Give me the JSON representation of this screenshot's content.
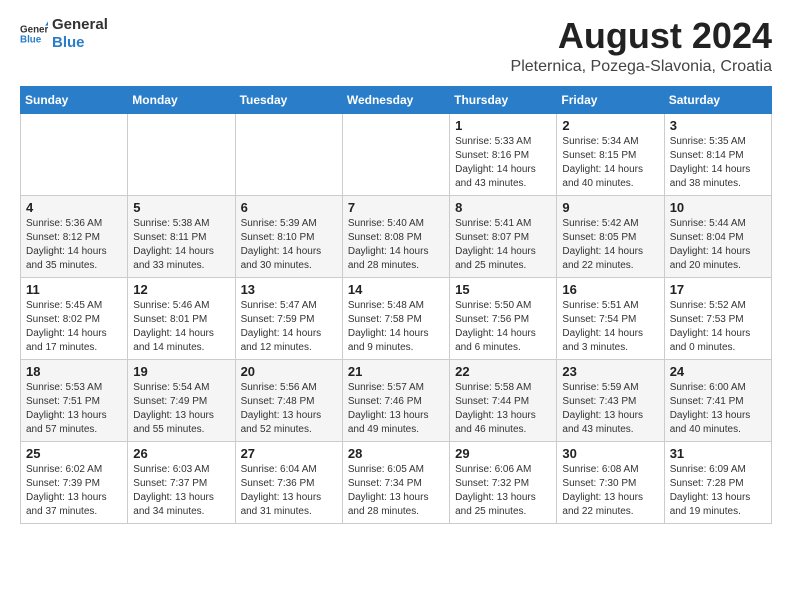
{
  "header": {
    "logo_general": "General",
    "logo_blue": "Blue",
    "month_title": "August 2024",
    "location": "Pleternica, Pozega-Slavonia, Croatia"
  },
  "days_of_week": [
    "Sunday",
    "Monday",
    "Tuesday",
    "Wednesday",
    "Thursday",
    "Friday",
    "Saturday"
  ],
  "weeks": [
    [
      {
        "day": "",
        "text": ""
      },
      {
        "day": "",
        "text": ""
      },
      {
        "day": "",
        "text": ""
      },
      {
        "day": "",
        "text": ""
      },
      {
        "day": "1",
        "text": "Sunrise: 5:33 AM\nSunset: 8:16 PM\nDaylight: 14 hours\nand 43 minutes."
      },
      {
        "day": "2",
        "text": "Sunrise: 5:34 AM\nSunset: 8:15 PM\nDaylight: 14 hours\nand 40 minutes."
      },
      {
        "day": "3",
        "text": "Sunrise: 5:35 AM\nSunset: 8:14 PM\nDaylight: 14 hours\nand 38 minutes."
      }
    ],
    [
      {
        "day": "4",
        "text": "Sunrise: 5:36 AM\nSunset: 8:12 PM\nDaylight: 14 hours\nand 35 minutes."
      },
      {
        "day": "5",
        "text": "Sunrise: 5:38 AM\nSunset: 8:11 PM\nDaylight: 14 hours\nand 33 minutes."
      },
      {
        "day": "6",
        "text": "Sunrise: 5:39 AM\nSunset: 8:10 PM\nDaylight: 14 hours\nand 30 minutes."
      },
      {
        "day": "7",
        "text": "Sunrise: 5:40 AM\nSunset: 8:08 PM\nDaylight: 14 hours\nand 28 minutes."
      },
      {
        "day": "8",
        "text": "Sunrise: 5:41 AM\nSunset: 8:07 PM\nDaylight: 14 hours\nand 25 minutes."
      },
      {
        "day": "9",
        "text": "Sunrise: 5:42 AM\nSunset: 8:05 PM\nDaylight: 14 hours\nand 22 minutes."
      },
      {
        "day": "10",
        "text": "Sunrise: 5:44 AM\nSunset: 8:04 PM\nDaylight: 14 hours\nand 20 minutes."
      }
    ],
    [
      {
        "day": "11",
        "text": "Sunrise: 5:45 AM\nSunset: 8:02 PM\nDaylight: 14 hours\nand 17 minutes."
      },
      {
        "day": "12",
        "text": "Sunrise: 5:46 AM\nSunset: 8:01 PM\nDaylight: 14 hours\nand 14 minutes."
      },
      {
        "day": "13",
        "text": "Sunrise: 5:47 AM\nSunset: 7:59 PM\nDaylight: 14 hours\nand 12 minutes."
      },
      {
        "day": "14",
        "text": "Sunrise: 5:48 AM\nSunset: 7:58 PM\nDaylight: 14 hours\nand 9 minutes."
      },
      {
        "day": "15",
        "text": "Sunrise: 5:50 AM\nSunset: 7:56 PM\nDaylight: 14 hours\nand 6 minutes."
      },
      {
        "day": "16",
        "text": "Sunrise: 5:51 AM\nSunset: 7:54 PM\nDaylight: 14 hours\nand 3 minutes."
      },
      {
        "day": "17",
        "text": "Sunrise: 5:52 AM\nSunset: 7:53 PM\nDaylight: 14 hours\nand 0 minutes."
      }
    ],
    [
      {
        "day": "18",
        "text": "Sunrise: 5:53 AM\nSunset: 7:51 PM\nDaylight: 13 hours\nand 57 minutes."
      },
      {
        "day": "19",
        "text": "Sunrise: 5:54 AM\nSunset: 7:49 PM\nDaylight: 13 hours\nand 55 minutes."
      },
      {
        "day": "20",
        "text": "Sunrise: 5:56 AM\nSunset: 7:48 PM\nDaylight: 13 hours\nand 52 minutes."
      },
      {
        "day": "21",
        "text": "Sunrise: 5:57 AM\nSunset: 7:46 PM\nDaylight: 13 hours\nand 49 minutes."
      },
      {
        "day": "22",
        "text": "Sunrise: 5:58 AM\nSunset: 7:44 PM\nDaylight: 13 hours\nand 46 minutes."
      },
      {
        "day": "23",
        "text": "Sunrise: 5:59 AM\nSunset: 7:43 PM\nDaylight: 13 hours\nand 43 minutes."
      },
      {
        "day": "24",
        "text": "Sunrise: 6:00 AM\nSunset: 7:41 PM\nDaylight: 13 hours\nand 40 minutes."
      }
    ],
    [
      {
        "day": "25",
        "text": "Sunrise: 6:02 AM\nSunset: 7:39 PM\nDaylight: 13 hours\nand 37 minutes."
      },
      {
        "day": "26",
        "text": "Sunrise: 6:03 AM\nSunset: 7:37 PM\nDaylight: 13 hours\nand 34 minutes."
      },
      {
        "day": "27",
        "text": "Sunrise: 6:04 AM\nSunset: 7:36 PM\nDaylight: 13 hours\nand 31 minutes."
      },
      {
        "day": "28",
        "text": "Sunrise: 6:05 AM\nSunset: 7:34 PM\nDaylight: 13 hours\nand 28 minutes."
      },
      {
        "day": "29",
        "text": "Sunrise: 6:06 AM\nSunset: 7:32 PM\nDaylight: 13 hours\nand 25 minutes."
      },
      {
        "day": "30",
        "text": "Sunrise: 6:08 AM\nSunset: 7:30 PM\nDaylight: 13 hours\nand 22 minutes."
      },
      {
        "day": "31",
        "text": "Sunrise: 6:09 AM\nSunset: 7:28 PM\nDaylight: 13 hours\nand 19 minutes."
      }
    ]
  ]
}
